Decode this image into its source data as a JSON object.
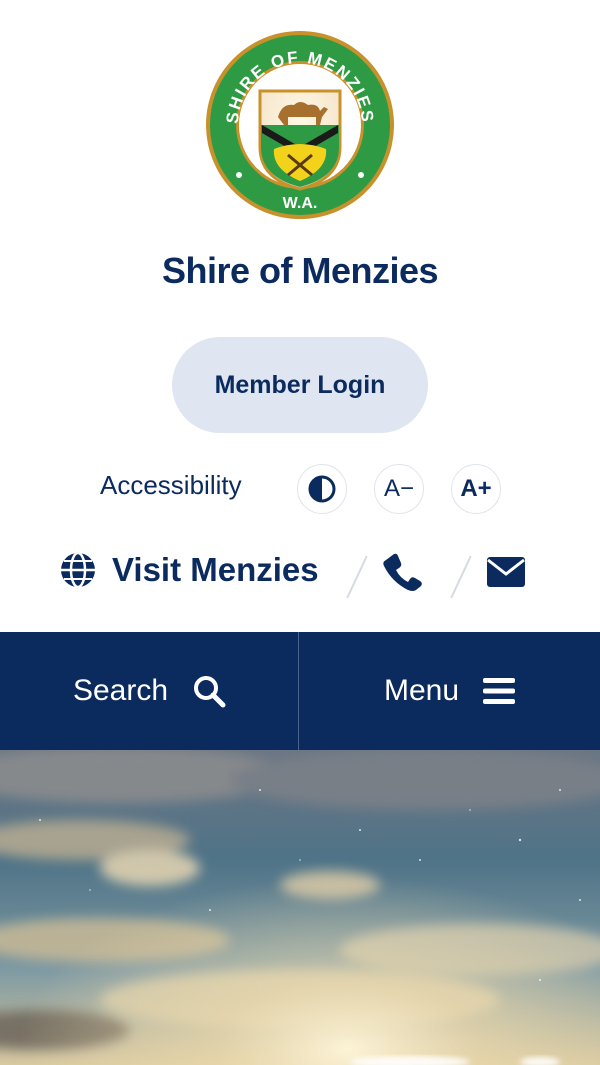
{
  "header": {
    "logo": {
      "icon": "shire-of-menzies-seal-logo",
      "seal_top_text": "SHIRE OF MENZIES",
      "seal_bottom_text": "W.A."
    },
    "site_title": "Shire of Menzies",
    "member_login_label": "Member Login"
  },
  "accessibility": {
    "label": "Accessibility",
    "contrast_icon": "contrast-icon",
    "decrease_label": "A−",
    "increase_label": "A+"
  },
  "quick_links": {
    "visit_label": "Visit Menzies",
    "visit_icon": "globe-icon",
    "phone_icon": "phone-icon",
    "email_icon": "envelope-icon"
  },
  "navbar": {
    "search_label": "Search",
    "search_icon": "search-icon",
    "menu_label": "Menu",
    "menu_icon": "hamburger-menu-icon"
  },
  "hero": {
    "image": "dusk-sky-with-clouds-and-stars"
  },
  "colors": {
    "primary_navy": "#0b2a5e",
    "login_button_bg": "#dfe6f2",
    "seal_green": "#2f9a44",
    "seal_gold": "#c8912c",
    "white": "#ffffff"
  }
}
